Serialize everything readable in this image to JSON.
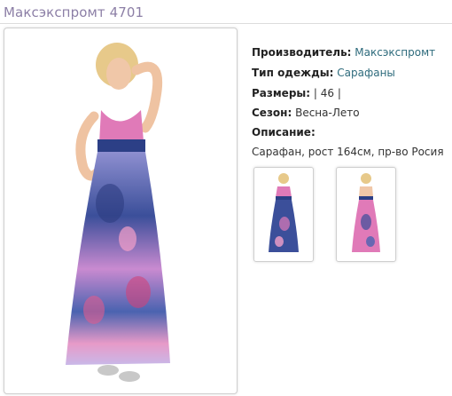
{
  "title": "Максэкспромт 4701",
  "details": {
    "manufacturer_label": "Производитель:",
    "manufacturer_value": "Максэкспромт",
    "type_label": "Тип одежды:",
    "type_value": "Сарафаны",
    "sizes_label": "Размеры:",
    "sizes_value": "| 46 |",
    "season_label": "Сезон:",
    "season_value": "Весна-Лето",
    "description_label": "Описание:",
    "description_text": "Сарафан, рост 164см, пр-во Росия"
  },
  "colors": {
    "title": "#8c7fa6",
    "link": "#2e6b7c",
    "dress_blue": "#3b4f9a",
    "dress_pink": "#e07ab8"
  }
}
